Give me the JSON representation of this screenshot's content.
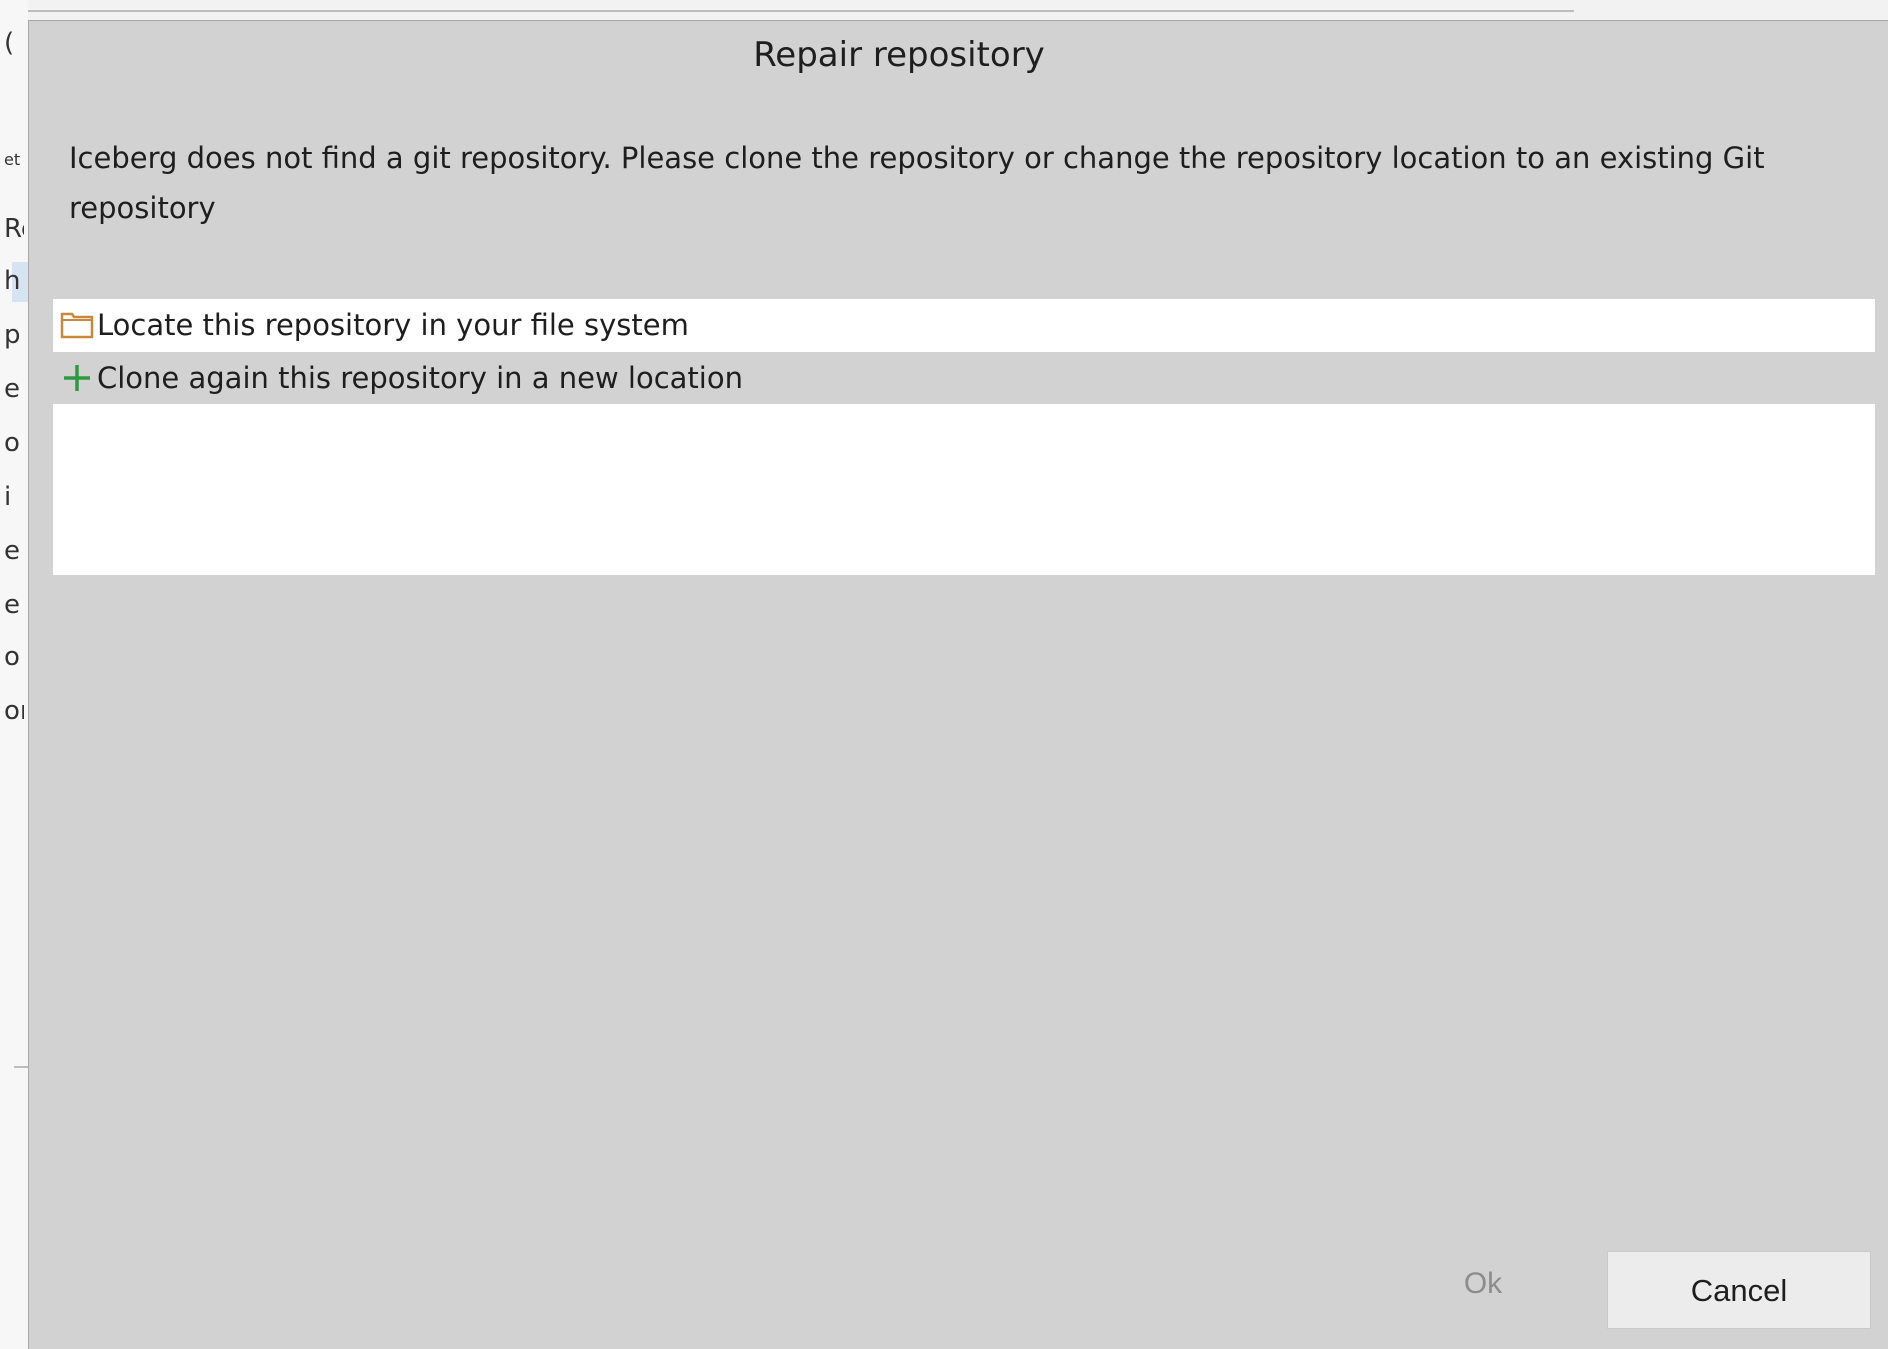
{
  "dialog": {
    "title": "Repair repository",
    "message": "Iceberg does not find a git repository. Please clone the repository or change the repository location to an existing Git repository",
    "options": [
      {
        "label": "Locate this repository in your file system",
        "icon": "folder-icon"
      },
      {
        "label": "Clone again this repository in a new location",
        "icon": "plus-icon"
      }
    ],
    "ok_label": "Ok",
    "cancel_label": "Cancel"
  },
  "background_fragments": [
    "(",
    "et",
    "Re",
    "h",
    "p",
    "e",
    "o",
    "i",
    "e",
    "e",
    "o",
    "or"
  ],
  "colors": {
    "dialog_bg": "#d2d2d2",
    "list_bg": "#ffffff",
    "folder_icon": "#c8873a",
    "plus_icon": "#2e9a3f",
    "disabled_text": "#8c8c8c"
  }
}
